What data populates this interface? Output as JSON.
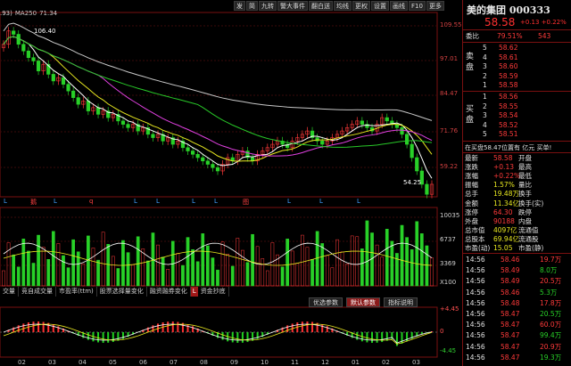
{
  "toolbar": [
    "发",
    "简",
    "九转",
    "警大事件",
    "",
    "翻白送",
    "均线",
    "更权",
    "设置",
    "画线",
    "F10",
    "更多"
  ],
  "legend": {
    "prefix": ".93)",
    "ma_label": "MA250",
    "ma_value": "71.34"
  },
  "price_axis": [
    "109.55",
    "97.01",
    "84.47",
    "71.76",
    "59.22"
  ],
  "volume_axis": [
    "10035",
    "6737",
    "3369",
    "X100"
  ],
  "macd_axis": [
    "+4.45",
    "0",
    "-4.45"
  ],
  "annotations": {
    "high": "106.40",
    "low": "54.25"
  },
  "event_marks": [
    "L",
    "鹅",
    "L",
    "q",
    "L",
    "L",
    "L",
    "L",
    "图",
    "L",
    "L",
    "L"
  ],
  "date_ticks": [
    "02",
    "03",
    "04",
    "05",
    "06",
    "07",
    "08",
    "09",
    "10",
    "11",
    "12",
    "01",
    "02",
    "03"
  ],
  "indicator_tabs": [
    "交量",
    "竞自成交量",
    "市盈率(ttm)",
    "股票选择量变化",
    "融资融券变化",
    "资金抄底"
  ],
  "indicator_tab_badge": "L",
  "macd_tabs": [
    {
      "label": "优选参数",
      "active": false
    },
    {
      "label": "默认参数",
      "active": true
    },
    {
      "label": "指标说明",
      "active": false
    }
  ],
  "quote": {
    "title": "美的集团 000333",
    "price": "58.58",
    "change": "+0.13",
    "change_pct": "+0.22%",
    "commission_ratio_label": "委比",
    "commission_ratio": "79.51%",
    "commission_diff": "543",
    "sell_side_label": "卖盘",
    "buy_side_label": "买盘",
    "asks": [
      {
        "level": "5",
        "price": "58.62",
        "vol": ""
      },
      {
        "level": "4",
        "price": "58.61",
        "vol": ""
      },
      {
        "level": "3",
        "price": "58.60",
        "vol": ""
      },
      {
        "level": "2",
        "price": "58.59",
        "vol": ""
      },
      {
        "level": "1",
        "price": "58.58",
        "vol": ""
      }
    ],
    "bids": [
      {
        "level": "1",
        "price": "58.56",
        "vol": ""
      },
      {
        "level": "2",
        "price": "58.55",
        "vol": ""
      },
      {
        "level": "3",
        "price": "58.54",
        "vol": ""
      },
      {
        "level": "4",
        "price": "58.52",
        "vol": ""
      },
      {
        "level": "5",
        "price": "58.51",
        "vol": ""
      }
    ],
    "status": "在买盘58.47位置有 亿元 买单!",
    "stats": [
      {
        "l1": "最新",
        "v1": "58.58",
        "l2": "开盘",
        "v2": ""
      },
      {
        "l1": "涨跌",
        "v1": "+0.13",
        "l2": "最高",
        "v2": ""
      },
      {
        "l1": "涨幅",
        "v1": "+0.22%",
        "l2": "最低",
        "v2": ""
      },
      {
        "l1": "振幅",
        "v1": "1.57%",
        "l2": "量比",
        "v2": ""
      },
      {
        "l1": "总手",
        "v1": "19.48万",
        "l2": "换手",
        "v2": ""
      },
      {
        "l1": "金额",
        "v1": "11.34亿",
        "l2": "换手(实)",
        "v2": ""
      },
      {
        "l1": "涨停",
        "v1": "64.30",
        "l2": "跌停",
        "v2": ""
      },
      {
        "l1": "外盘",
        "v1": "90188",
        "l2": "内盘",
        "v2": ""
      },
      {
        "l1": "总市值",
        "v1": "4097亿",
        "l2": "流通值",
        "v2": ""
      },
      {
        "l1": "总股本",
        "v1": "69.94亿",
        "l2": "流通股",
        "v2": ""
      },
      {
        "l1": "市盈(动)",
        "v1": "15.05",
        "l2": "市盈(静)",
        "v2": ""
      }
    ],
    "ticks": [
      {
        "time": "14:56",
        "price": "58.46",
        "vol": "19.7万"
      },
      {
        "time": "14:56",
        "price": "58.49",
        "vol": "8.0万"
      },
      {
        "time": "14:56",
        "price": "58.49",
        "vol": "20.5万"
      },
      {
        "time": "14:56",
        "price": "58.46",
        "vol": "5.3万"
      },
      {
        "time": "14:56",
        "price": "58.48",
        "vol": "17.8万"
      },
      {
        "time": "14:56",
        "price": "58.47",
        "vol": "20.5万"
      },
      {
        "time": "14:56",
        "price": "58.47",
        "vol": "60.0万"
      },
      {
        "time": "14:56",
        "price": "58.47",
        "vol": "99.4万"
      },
      {
        "time": "14:56",
        "price": "58.47",
        "vol": "20.9万"
      },
      {
        "time": "14:56",
        "price": "58.47",
        "vol": "19.3万"
      }
    ]
  },
  "colors": {
    "up": "#ff3a3a",
    "down": "#28d028",
    "ma5": "#ffffff",
    "ma10": "#e8e820",
    "ma20": "#e040e0",
    "ma60": "#28c828",
    "ma250": "#c8c8c8",
    "accent": "#7a1010"
  },
  "chart_data": {
    "type": "candlestick",
    "series": [
      {
        "name": "MA250",
        "values": []
      }
    ],
    "close": [
      100,
      104,
      103,
      100,
      98,
      96,
      95,
      92,
      94,
      91,
      89,
      90,
      88,
      86,
      84,
      82,
      83,
      80,
      81,
      79,
      80,
      78,
      79,
      77,
      76,
      75,
      76,
      74,
      75,
      73,
      72,
      73,
      71,
      72,
      70,
      71,
      69,
      68,
      67,
      66,
      65,
      64,
      63,
      62,
      64,
      66,
      65,
      67,
      68,
      66,
      65,
      67,
      68,
      69,
      70,
      71,
      70,
      69,
      71,
      72,
      73,
      74,
      72,
      71,
      70,
      71,
      72,
      73,
      74,
      75,
      76,
      77,
      76,
      75,
      74,
      76,
      78,
      77,
      76,
      75,
      73,
      70,
      66,
      62,
      58,
      55,
      58
    ],
    "ylim": [
      54.25,
      109.55
    ],
    "volume_ylim": [
      0,
      10035
    ],
    "macd_ylim": [
      -4.45,
      4.45
    ]
  }
}
